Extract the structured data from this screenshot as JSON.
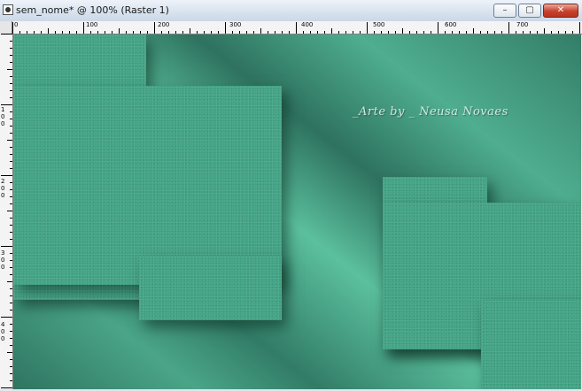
{
  "window": {
    "title": "sem_nome* @ 100% (Raster 1)",
    "icon": "psp-document-icon",
    "buttons": {
      "minimize": "–",
      "maximize": "▢",
      "close": "✕"
    }
  },
  "rulers": {
    "horizontal": [
      "0",
      "100",
      "200",
      "300",
      "400",
      "500",
      "600",
      "700"
    ],
    "vertical": [
      "1 0 0",
      "2 0 0",
      "3 0 0",
      "4 0 0"
    ]
  },
  "canvas": {
    "watermark": "_Arte by _ Neusa Novaes",
    "colors": {
      "shape": "#43a485",
      "background_dark": "#2f7461",
      "background_light": "#5bc09d"
    }
  }
}
